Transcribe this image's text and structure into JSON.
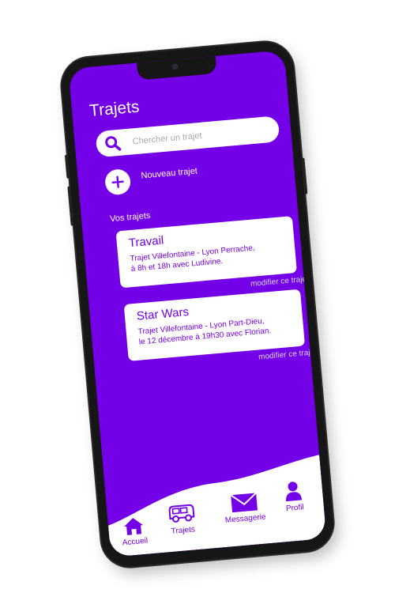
{
  "screen": {
    "title": "Trajets",
    "search": {
      "placeholder": "Chercher un trajet",
      "icon": "search-icon"
    },
    "new_trip": {
      "label": "Nouveau trajet",
      "icon": "plus-icon"
    },
    "section_title": "Vos trajets",
    "trips": [
      {
        "title": "Travail",
        "description_line1": "Trajet Villefontaine - Lyon Perrache,",
        "description_line2": "à 8h et 18h avec Ludivine.",
        "edit_label": "modifier ce trajet"
      },
      {
        "title": "Star Wars",
        "description_line1": "Trajet Villefontaine - Lyon Part-Dieu,",
        "description_line2": "le 12 décembre à 19h30 avec Florian.",
        "edit_label": "modifier ce trajet"
      }
    ]
  },
  "bottom_nav": [
    {
      "label": "Accueil",
      "icon": "home-icon"
    },
    {
      "label": "Trajets",
      "icon": "car-icon"
    },
    {
      "label": "Messagerie",
      "icon": "mail-icon"
    },
    {
      "label": "Profil",
      "icon": "user-icon"
    }
  ],
  "colors": {
    "accent": "#7400e8",
    "background": "#ffffff",
    "phone_frame": "#161616",
    "link_text": "#d8d8ff"
  }
}
